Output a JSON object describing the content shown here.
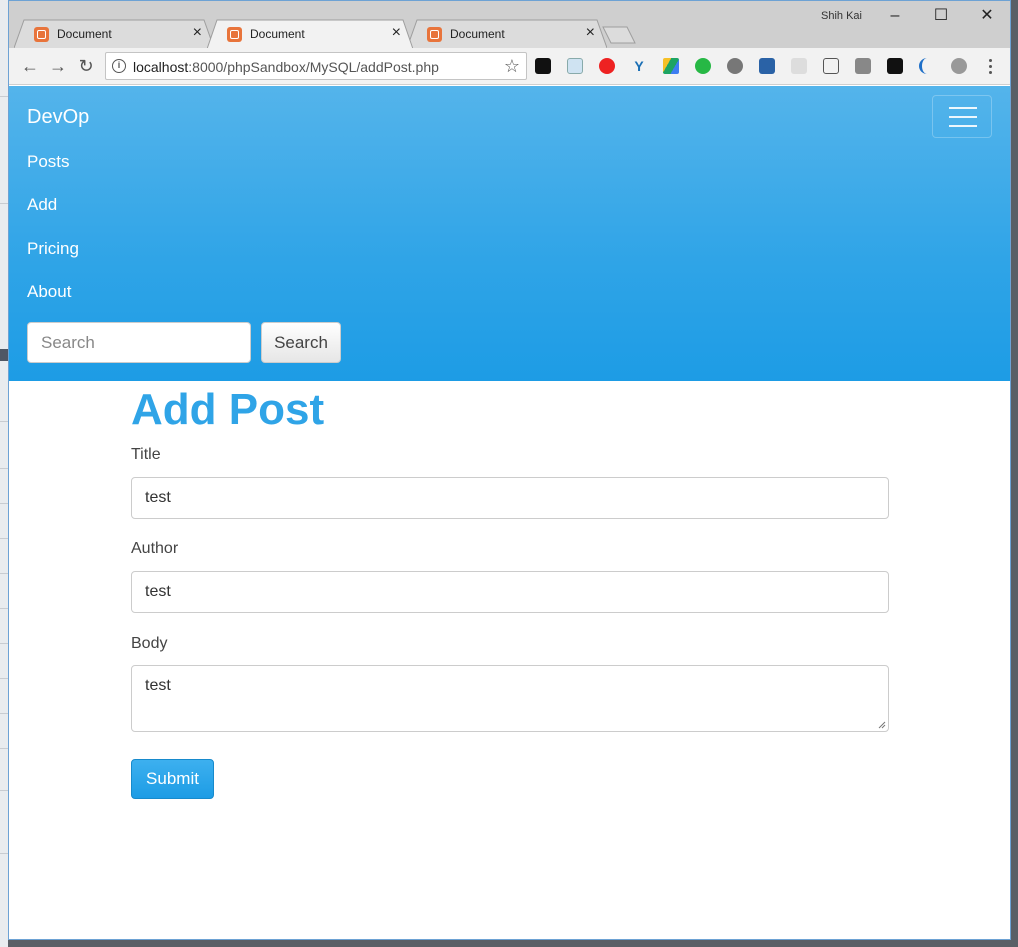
{
  "browser": {
    "tabs": [
      {
        "label": "Document"
      },
      {
        "label": "Document"
      },
      {
        "label": "Document"
      }
    ],
    "user_name": "Shih Kai",
    "url_host": "localhost",
    "url_rest": ":8000/phpSandbox/MySQL/addPost.php",
    "extensions": [
      "evernote-icon",
      "photo-icon",
      "opera-icon",
      "vivaldi-icon",
      "google-drive-icon",
      "pushbullet-icon",
      "line-icon",
      "onenote-icon",
      "reader-icon",
      "download-icon",
      "cb-icon",
      "fullscreen-icon",
      "wave-icon",
      "settings-icon"
    ]
  },
  "navbar": {
    "brand": "DevOp",
    "links": [
      "Posts",
      "Add",
      "Pricing",
      "About"
    ],
    "search_placeholder": "Search",
    "search_button": "Search"
  },
  "form": {
    "title": "Add Post",
    "title_label": "Title",
    "title_value": "test",
    "author_label": "Author",
    "author_value": "test",
    "body_label": "Body",
    "body_value": "test",
    "submit_label": "Submit"
  },
  "colors": {
    "primary": "#2fa4e7",
    "navbar_top": "#54b4eb",
    "navbar_bottom": "#1d9ce5"
  }
}
